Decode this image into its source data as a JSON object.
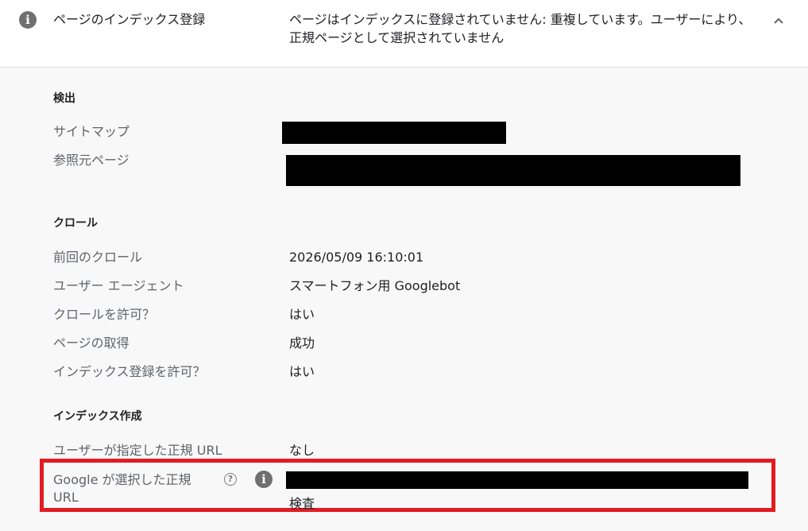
{
  "header": {
    "info_icon": "i",
    "title": "ページのインデックス登録",
    "status": "ページはインデックスに登録されていません: 重複しています。ユーザーにより、正規ページとして選択されていません",
    "chevron_icon": "chevron-up-icon"
  },
  "detection": {
    "title": "検出",
    "sitemap_label": "サイトマップ",
    "referring_page_label": "参照元ページ"
  },
  "crawl": {
    "title": "クロール",
    "last_crawl_label": "前回のクロール",
    "last_crawl_value": "2026/05/09 16:10:01",
    "user_agent_label": "ユーザー エージェント",
    "user_agent_value": "スマートフォン用 Googlebot",
    "crawl_allowed_label": "クロールを許可？",
    "crawl_allowed_value": "はい",
    "page_fetch_label": "ページの取得",
    "page_fetch_value": "成功",
    "indexing_allowed_label": "インデックス登録を許可？",
    "indexing_allowed_value": "はい"
  },
  "indexing": {
    "title": "インデックス作成",
    "user_canonical_label": "ユーザーが指定した正規 URL",
    "user_canonical_value": "なし",
    "google_canonical_label_line1": "Google が選択した正規",
    "google_canonical_label_line2": "URL",
    "help_icon": "?",
    "info_icon": "i",
    "inspect_link": "検査"
  },
  "colors": {
    "highlight": "#e31b23",
    "icon_gray": "#6f6f6f",
    "label_gray": "#5f6368"
  }
}
